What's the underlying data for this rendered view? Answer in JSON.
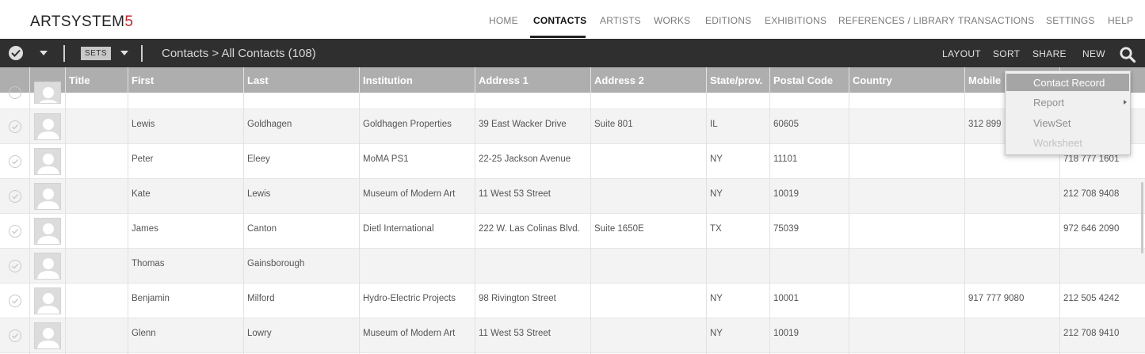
{
  "app": {
    "logo_text": "ARTSYSTEM",
    "logo_digit": "5",
    "logo_digit_color": "#c4262e"
  },
  "nav": {
    "items": [
      {
        "label": "HOME",
        "active": false
      },
      {
        "label": "CONTACTS",
        "active": true
      },
      {
        "label": "ARTISTS",
        "active": false
      },
      {
        "label": "WORKS",
        "active": false
      },
      {
        "label": "EDITIONS",
        "active": false
      },
      {
        "label": "EXHIBITIONS",
        "active": false
      },
      {
        "label": "REFERENCES / LIBRARY",
        "active": false
      },
      {
        "label": "TRANSACTIONS",
        "active": false
      },
      {
        "label": "SETTINGS",
        "active": false
      },
      {
        "label": "HELP",
        "active": false
      }
    ]
  },
  "toolbar": {
    "sets_label": "SETS",
    "breadcrumb": "Contacts > All Contacts (108)",
    "actions": [
      "LAYOUT",
      "SORT",
      "SHARE",
      "NEW"
    ],
    "search_icon": "search-icon"
  },
  "table": {
    "columns": [
      "Title",
      "First",
      "Last",
      "Institution",
      "Address 1",
      "Address 2",
      "State/prov.",
      "Postal Code",
      "Country",
      "Mobile"
    ],
    "rows": [
      {
        "first": "Lewis",
        "last": "Goldhagen",
        "institution": "Goldhagen Properties",
        "address1": "39 East Wacker Drive",
        "address2": "Suite 801",
        "state": "IL",
        "postal": "60605",
        "country": "",
        "mobile": "312 899",
        "phone": ""
      },
      {
        "first": "Peter",
        "last": "Eleey",
        "institution": "MoMA PS1",
        "address1": "22-25 Jackson Avenue",
        "address2": "",
        "state": "NY",
        "postal": "11101",
        "country": "",
        "mobile": "",
        "phone": "718 777 1601"
      },
      {
        "first": "Kate",
        "last": "Lewis",
        "institution": "Museum of Modern Art",
        "address1": "11 West 53 Street",
        "address2": "",
        "state": "NY",
        "postal": "10019",
        "country": "",
        "mobile": "",
        "phone": "212 708 9408"
      },
      {
        "first": "James",
        "last": "Canton",
        "institution": "Dietl International",
        "address1": "222 W. Las Colinas Blvd.",
        "address2": "Suite 1650E",
        "state": "TX",
        "postal": "75039",
        "country": "",
        "mobile": "",
        "phone": "972 646 2090"
      },
      {
        "first": "Thomas",
        "last": "Gainsborough",
        "institution": "",
        "address1": "",
        "address2": "",
        "state": "",
        "postal": "",
        "country": "",
        "mobile": "",
        "phone": ""
      },
      {
        "first": "Benjamin",
        "last": "Milford",
        "institution": "Hydro-Electric Projects",
        "address1": "98 Rivington Street",
        "address2": "",
        "state": "NY",
        "postal": "10001",
        "country": "",
        "mobile": "917 777 9080",
        "phone": "212 505 4242"
      },
      {
        "first": "Glenn",
        "last": "Lowry",
        "institution": "Museum of Modern Art",
        "address1": "11 West 53 Street",
        "address2": "",
        "state": "NY",
        "postal": "10019",
        "country": "",
        "mobile": "",
        "phone": "212 708 9410"
      }
    ]
  },
  "new_menu": {
    "items": [
      {
        "label": "Contact Record",
        "state": "active"
      },
      {
        "label": "Report",
        "state": "normal",
        "has_submenu": true
      },
      {
        "label": "ViewSet",
        "state": "normal"
      },
      {
        "label": "Worksheet",
        "state": "disabled"
      }
    ]
  },
  "colors": {
    "toolbar_bg": "#2f2f2f",
    "header_bg": "#aeaeae",
    "accent": "#c4262e"
  }
}
